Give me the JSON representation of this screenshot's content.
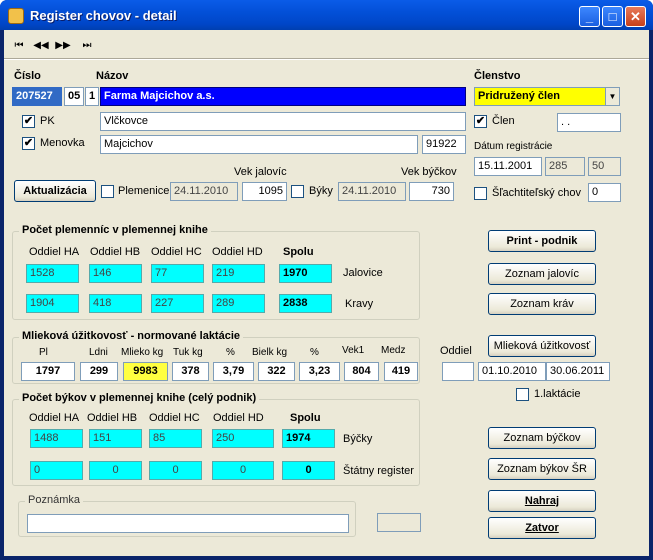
{
  "window": {
    "title": "Register chovov - detail"
  },
  "nav": [
    "⏮",
    "◀◀",
    "▶▶",
    "⏭"
  ],
  "header": {
    "cislo_label": "Číslo",
    "nazov_label": "Názov",
    "clenstvo_label": "Členstvo",
    "cislo": "207527",
    "cislo2": "05",
    "cislo3": "1",
    "nazov": "Farma Majcichov a.s.",
    "clenstvo": "Pridružený člen"
  },
  "pk": {
    "label": "PK",
    "value": "Vlčkovce",
    "checked": "✔"
  },
  "clen": {
    "label": "Člen",
    "value": ". .",
    "checked": "✔"
  },
  "menovka": {
    "label": "Menovka",
    "value": "Majcichov",
    "code": "91922",
    "checked": "✔"
  },
  "datum": {
    "label": "Dátum registrácie",
    "value": "15.11.2001",
    "v2": "285",
    "v3": "50"
  },
  "sl": {
    "label": "Šľachtiteľský chov",
    "value": "0"
  },
  "aktualizacia": {
    "button": "Aktualizácia",
    "plemenice_label": "Plemenice",
    "plemenice_date": "24.11.2010",
    "vek_jalovic_label": "Vek jalovíc",
    "vek_jalovic": "1095",
    "byky_label": "Býky",
    "byky_date": "24.11.2010",
    "vek_byckov_label": "Vek býčkov",
    "vek_byckov": "730"
  },
  "plemenic": {
    "title": "Počet plemenníc v plemennej knihe",
    "headers": [
      "Oddiel HA",
      "Oddiel HB",
      "Oddiel HC",
      "Oddiel HD",
      "Spolu"
    ],
    "rows": [
      {
        "label": "Jalovice",
        "values": [
          "1528",
          "146",
          "77",
          "219",
          "1970"
        ]
      },
      {
        "label": "Kravy",
        "values": [
          "1904",
          "418",
          "227",
          "289",
          "2838"
        ]
      }
    ]
  },
  "mlieko": {
    "title": "Mlieková úžitkovosť - normované laktácie",
    "headers": [
      "Pl",
      "Ldni",
      "Mlieko kg",
      "Tuk kg",
      "%",
      "Bielk kg",
      "%",
      "Vek1",
      "Medz"
    ],
    "values": [
      "1797",
      "299",
      "9983",
      "378",
      "3,79",
      "322",
      "3,23",
      "804",
      "419"
    ]
  },
  "oddiel": {
    "label": "Oddiel",
    "value": "",
    "od": "01.10.2010",
    "do": "30.06.2011",
    "laktacie": "1.laktácie"
  },
  "bykov": {
    "title": "Počet býkov v plemennej knihe (celý podnik)",
    "headers": [
      "Oddiel HA",
      "Oddiel HB",
      "Oddiel HC",
      "Oddiel HD",
      "Spolu"
    ],
    "rows": [
      {
        "label": "Býčky",
        "values": [
          "1488",
          "151",
          "85",
          "250",
          "1974"
        ]
      },
      {
        "label": "Štátny register",
        "values": [
          "0",
          "0",
          "0",
          "0",
          "0"
        ]
      }
    ]
  },
  "poznamka": {
    "label": "Poznámka",
    "value": ""
  },
  "buttons": {
    "print": "Print - podnik",
    "jalovic": "Zoznam jalovíc",
    "krav": "Zoznam kráv",
    "mlieko": "Mlieková úžitkovosť",
    "byckov": "Zoznam býčkov",
    "bykov_sr": "Zoznam býkov ŠR",
    "nahraj": "Nahraj",
    "zatvor": "Zatvor"
  },
  "colors": {
    "accent": "#0000ff",
    "highlight": "#ffff00",
    "cyan": "#00ffff"
  }
}
